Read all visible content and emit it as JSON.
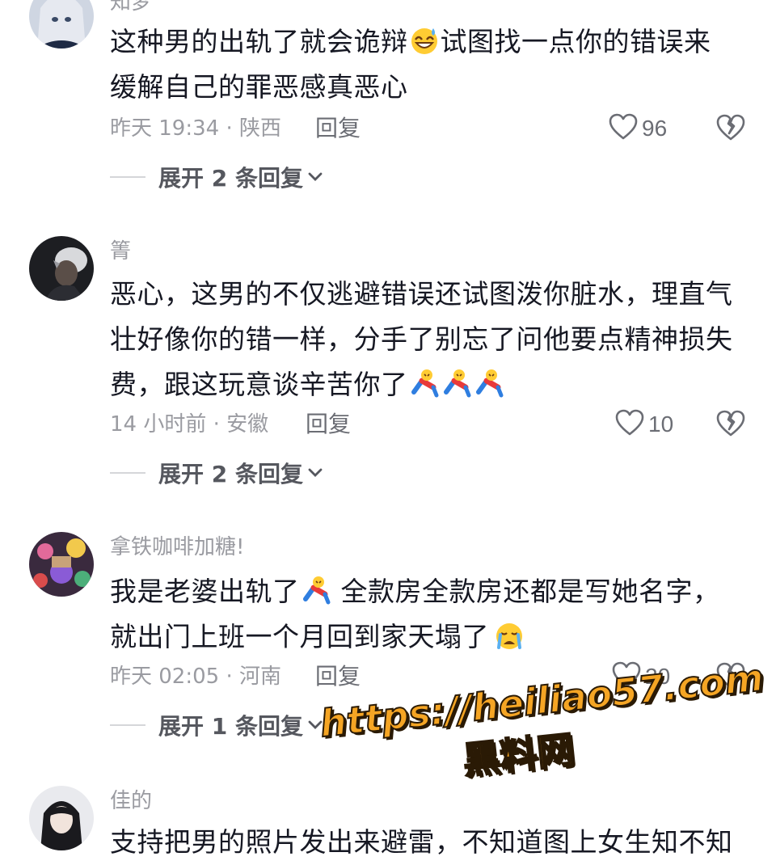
{
  "comments": [
    {
      "username": "知梦",
      "text_lines": [
        "这种男的出轨了就会诡辩",
        "试图找一点你的错误来",
        "缓解自己的罪恶感真恶心"
      ],
      "emoji": "grinning-sweat-emoji",
      "time_location": "昨天 19:34 · 陕西",
      "reply_label": "回复",
      "likes": "96",
      "expand_label": "展开 2 条回复"
    },
    {
      "username": "箐",
      "text_lines": [
        "恶心，这男的不仅逃避错误还试图泼你脏水，理直气",
        "壮好像你的错一样，分手了别忘了问他要点精神损失",
        "费，跟这玩意谈辛苦你了"
      ],
      "emoji": "falling-person-emoji",
      "time_location": "14 小时前 · 安徽",
      "reply_label": "回复",
      "likes": "10",
      "expand_label": "展开 2 条回复"
    },
    {
      "username": "拿铁咖啡加糖!",
      "text_lines": [
        "我是老婆出轨了",
        "全款房全款房还都是写她名字，",
        "就出门上班一个月回到家天塌了"
      ],
      "emoji": "falling-person-emoji",
      "emoji2": "crying-face-emoji",
      "time_location": "昨天 02:05 · 河南",
      "reply_label": "回复",
      "likes": "20",
      "expand_label": "展开 1 条回复"
    },
    {
      "username": "佳的",
      "text_lines": [
        "支持把男的照片发出来避雷，不知道图上女生知不知"
      ]
    }
  ],
  "watermark": {
    "url": "https://heiliao57.com",
    "name": "黑料网"
  },
  "colors": {
    "text": "#161823",
    "meta": "#9a9ba1",
    "action": "#6b6d74",
    "watermark": "#f5a524"
  }
}
